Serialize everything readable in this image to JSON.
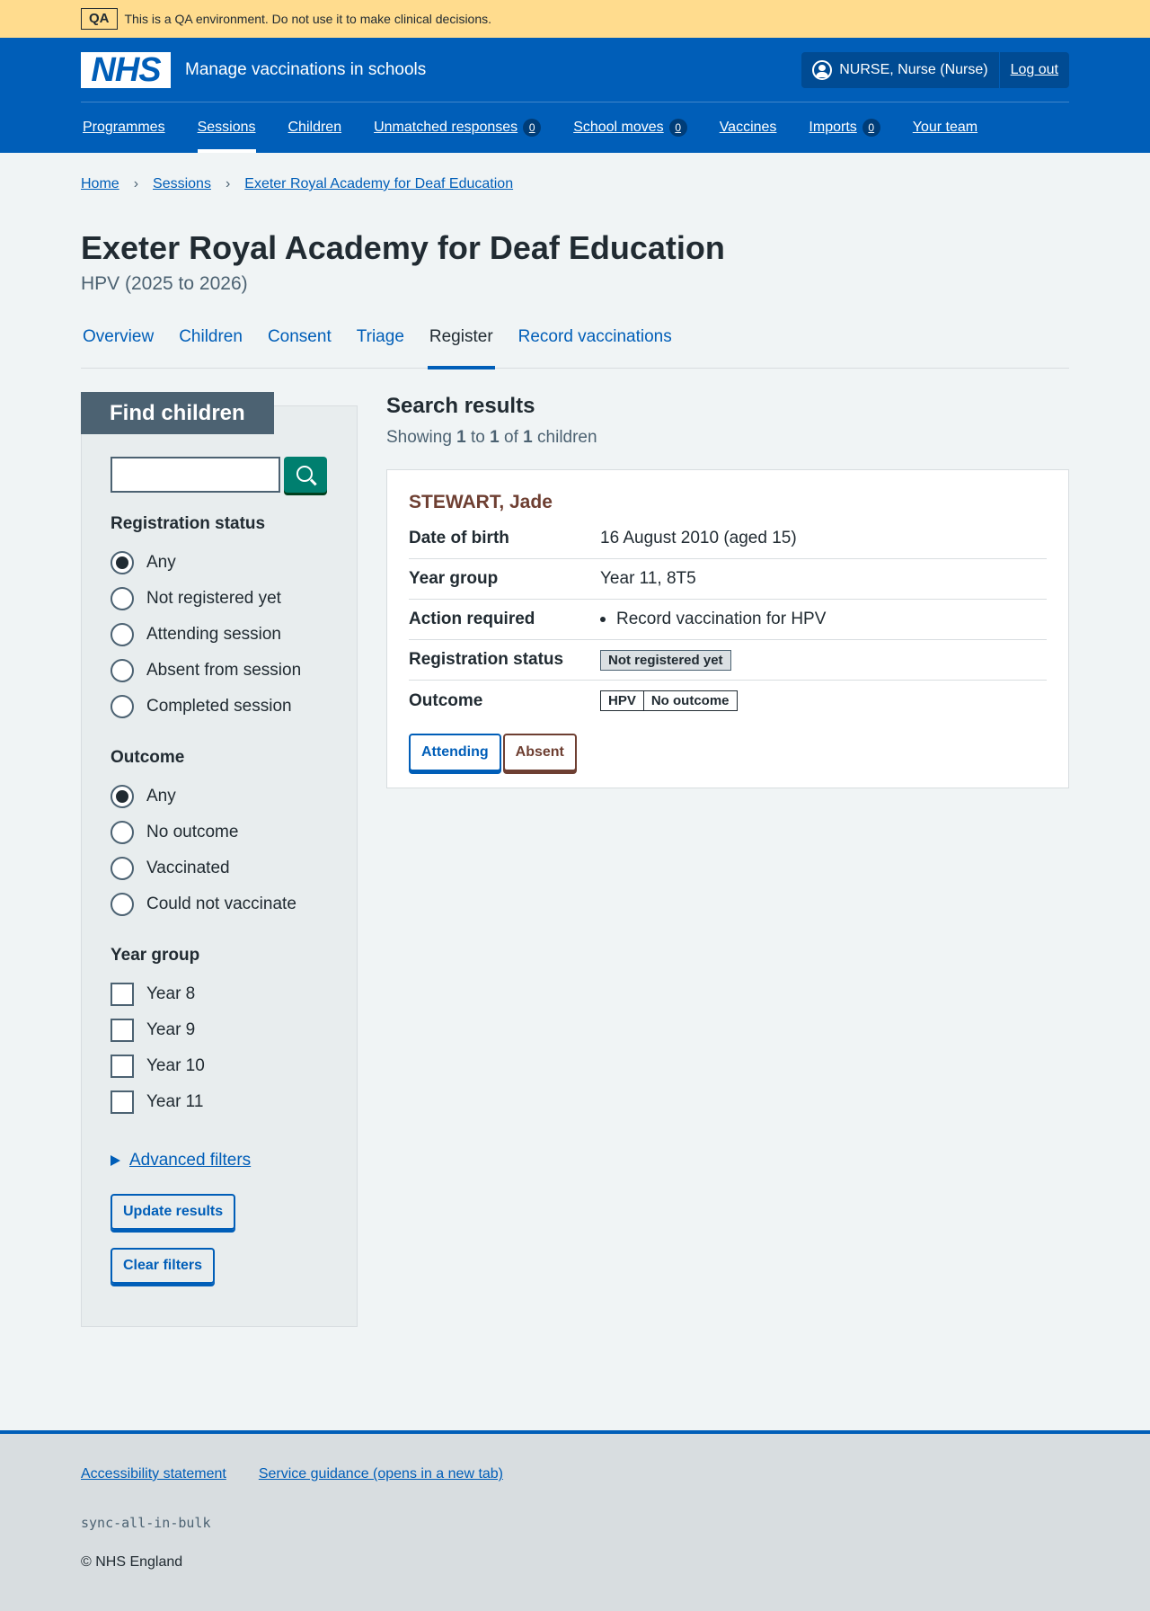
{
  "qa_banner": {
    "tag": "QA",
    "text": "This is a QA environment. Do not use it to make clinical decisions."
  },
  "header": {
    "logo": "NHS",
    "service_name": "Manage vaccinations in schools",
    "user": "NURSE, Nurse (Nurse)",
    "logout": "Log out",
    "nav": [
      {
        "label": "Programmes"
      },
      {
        "label": "Sessions",
        "active": true
      },
      {
        "label": "Children"
      },
      {
        "label": "Unmatched responses",
        "badge": "0"
      },
      {
        "label": "School moves",
        "badge": "0"
      },
      {
        "label": "Vaccines"
      },
      {
        "label": "Imports",
        "badge": "0"
      },
      {
        "label": "Your team"
      }
    ]
  },
  "breadcrumb": [
    "Home",
    "Sessions",
    "Exeter Royal Academy for Deaf Education"
  ],
  "page": {
    "title": "Exeter Royal Academy for Deaf Education",
    "caption": "HPV (2025 to 2026)"
  },
  "tabs": [
    "Overview",
    "Children",
    "Consent",
    "Triage",
    "Register",
    "Record vaccinations"
  ],
  "filters": {
    "heading": "Find children",
    "search_value": "",
    "registration": {
      "legend": "Registration status",
      "options": [
        "Any",
        "Not registered yet",
        "Attending session",
        "Absent from session",
        "Completed session"
      ],
      "selected": "Any"
    },
    "outcome": {
      "legend": "Outcome",
      "options": [
        "Any",
        "No outcome",
        "Vaccinated",
        "Could not vaccinate"
      ],
      "selected": "Any"
    },
    "year_group": {
      "legend": "Year group",
      "options": [
        "Year 8",
        "Year 9",
        "Year 10",
        "Year 11"
      ]
    },
    "advanced": "Advanced filters",
    "update_button": "Update results",
    "clear_button": "Clear filters"
  },
  "results": {
    "title": "Search results",
    "count": {
      "prefix": "Showing",
      "from": "1",
      "to_word": "to",
      "to": "1",
      "of_word": "of",
      "total": "1",
      "suffix": "children"
    },
    "card": {
      "name": "STEWART, Jade",
      "rows": {
        "dob_label": "Date of birth",
        "dob": "16 August 2010 (aged 15)",
        "year_label": "Year group",
        "year": "Year 11, 8T5",
        "action_label": "Action required",
        "action": "Record vaccination for HPV",
        "registration_label": "Registration status",
        "registration": "Not registered yet",
        "outcome_label": "Outcome",
        "outcome_programme": "HPV",
        "outcome_status": "No outcome"
      },
      "attending_button": "Attending",
      "absent_button": "Absent"
    }
  },
  "footer": {
    "links": [
      "Accessibility statement",
      "Service guidance (opens in a new tab)"
    ],
    "code": "sync-all-in-bulk",
    "copyright": "© NHS England"
  }
}
